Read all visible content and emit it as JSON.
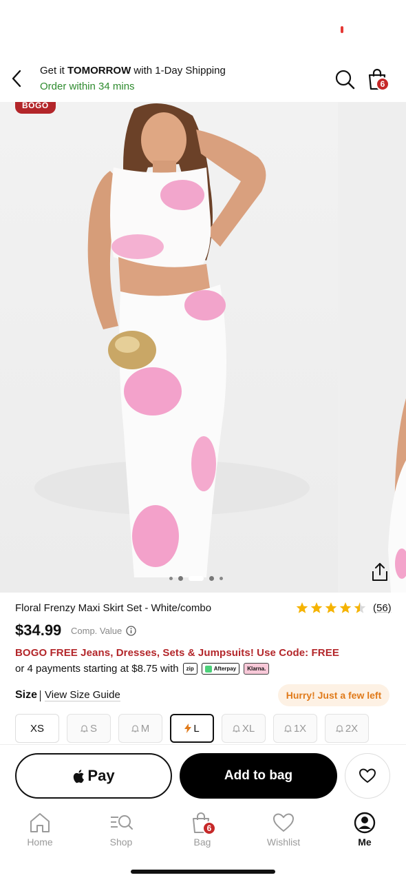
{
  "header": {
    "ship_prefix": "Get it ",
    "ship_bold": "TOMORROW",
    "ship_suffix": " with 1-Day Shipping",
    "order_within": "Order within 34 mins",
    "bag_count": "6"
  },
  "gallery": {
    "bogo_tag": "BOGO",
    "dot_count": 5,
    "active_dot": 2
  },
  "product": {
    "title": "Floral Frenzy Maxi Skirt Set - White/combo",
    "rating": 4.5,
    "rating_count": "(56)",
    "price": "$34.99",
    "comp_value_label": "Comp. Value",
    "promo": "BOGO FREE Jeans, Dresses, Sets & Jumpsuits! Use Code: FREE",
    "installments": "or 4 payments starting at $8.75 with",
    "pay_badges": [
      "zip",
      "Afterpay",
      "Klarna."
    ]
  },
  "size": {
    "label": "Size",
    "guide": "View Size Guide",
    "hurry": "Hurry! Just a few left",
    "options": [
      {
        "label": "XS",
        "state": "available"
      },
      {
        "label": "S",
        "state": "notify"
      },
      {
        "label": "M",
        "state": "notify"
      },
      {
        "label": "L",
        "state": "selected"
      },
      {
        "label": "XL",
        "state": "notify"
      },
      {
        "label": "1X",
        "state": "notify"
      },
      {
        "label": "2X",
        "state": "notify"
      }
    ]
  },
  "actions": {
    "apple_pay": "Pay",
    "add_to_bag": "Add to bag"
  },
  "tabs": [
    {
      "label": "Home",
      "icon": "home-icon"
    },
    {
      "label": "Shop",
      "icon": "shop-icon"
    },
    {
      "label": "Bag",
      "icon": "bag-icon",
      "badge": "6"
    },
    {
      "label": "Wishlist",
      "icon": "heart-icon"
    },
    {
      "label": "Me",
      "icon": "profile-icon",
      "active": true
    }
  ],
  "colors": {
    "accent_red": "#b3262a",
    "ship_green": "#2e8b2e",
    "hurry_orange": "#e07a1a",
    "star_gold": "#f5b301"
  }
}
